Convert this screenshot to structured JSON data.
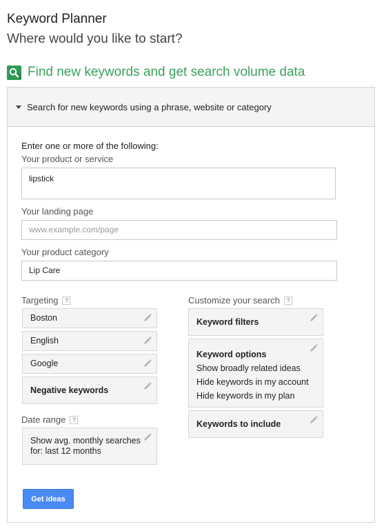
{
  "header": {
    "title": "Keyword Planner",
    "subtitle": "Where would you like to start?"
  },
  "section": {
    "icon": "search-icon",
    "title": "Find new keywords and get search volume data",
    "accent_color": "#3ba15c"
  },
  "panel": {
    "header": "Search for new keywords using a phrase, website or category",
    "intro": "Enter one or more of the following:",
    "product": {
      "label": "Your product or service",
      "value": "lipstick"
    },
    "landing": {
      "label": "Your landing page",
      "value": "",
      "placeholder": "www.example.com/page"
    },
    "category": {
      "label": "Your product category",
      "value": "Lip Care"
    }
  },
  "targeting": {
    "label": "Targeting",
    "help": "?",
    "items": [
      "Boston",
      "English",
      "Google"
    ],
    "negative": "Negative keywords"
  },
  "date_range": {
    "label": "Date range",
    "help": "?",
    "line1": "Show avg. monthly searches",
    "line2": "for: last 12 months"
  },
  "customize": {
    "label": "Customize your search",
    "help": "?",
    "filters": "Keyword filters",
    "options": {
      "title": "Keyword options",
      "lines": [
        "Show broadly related ideas",
        "Hide keywords in my account",
        "Hide keywords in my plan"
      ]
    },
    "include": "Keywords to include"
  },
  "actions": {
    "get_ideas": "Get ideas",
    "button_color": "#4a8af4"
  }
}
